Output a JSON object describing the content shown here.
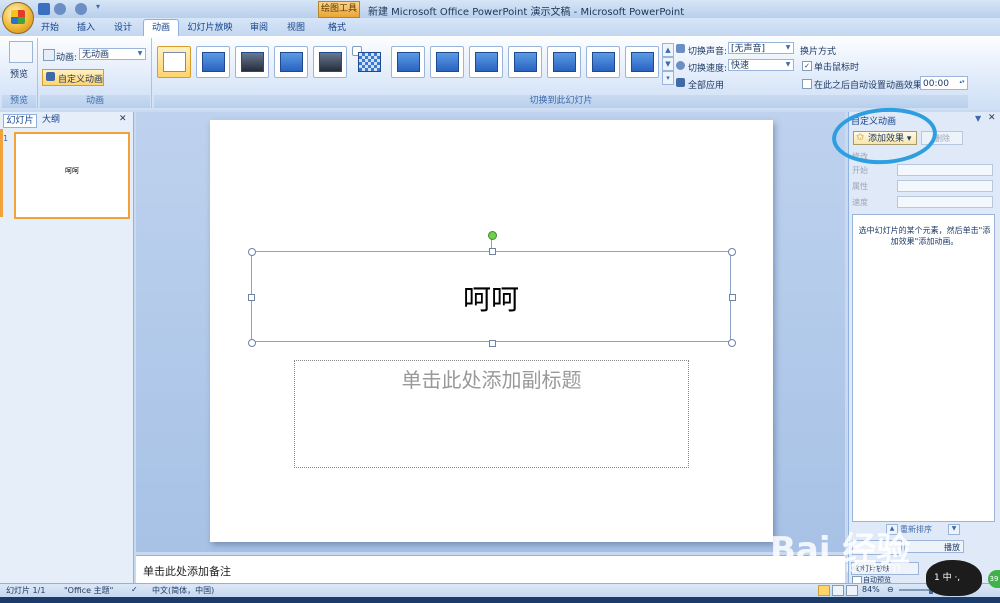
{
  "window": {
    "title": "新建 Microsoft Office PowerPoint 演示文稿 - Microsoft PowerPoint",
    "context_tab": "绘图工具"
  },
  "tabs": [
    {
      "label": "开始"
    },
    {
      "label": "插入"
    },
    {
      "label": "设计"
    },
    {
      "label": "动画",
      "active": true
    },
    {
      "label": "幻灯片放映"
    },
    {
      "label": "审阅"
    },
    {
      "label": "视图"
    },
    {
      "label": "格式"
    }
  ],
  "ribbon": {
    "preview": {
      "button_label": "预览",
      "group_label": "预览"
    },
    "animations": {
      "anim_label": "动画:",
      "anim_value": "无动画",
      "custom_button": "自定义动画",
      "group_label": "动画"
    },
    "transitions": {
      "group_label": "切换到此幻灯片",
      "sound_label": "切换声音:",
      "sound_value": "[无声音]",
      "speed_label": "切换速度:",
      "speed_value": "快速",
      "apply_all": "全部应用",
      "advance_title": "换片方式",
      "on_click": "单击鼠标时",
      "on_click_checked": true,
      "auto_label": "在此之后自动设置动画效果:",
      "auto_checked": false,
      "auto_time": "00:00"
    }
  },
  "slides_pane": {
    "tab_slides": "幻灯片",
    "tab_outline": "大纲",
    "close": "✕",
    "slide_number": "1",
    "thumb_title": "呵呵"
  },
  "slide": {
    "title": "呵呵",
    "subtitle_placeholder": "单击此处添加副标题"
  },
  "notes": {
    "placeholder": "单击此处添加备注"
  },
  "anim_pane": {
    "title": "自定义动画",
    "add_effect": "添加效果",
    "delete": "删除",
    "modify_label": "修改",
    "start_label": "开始",
    "property_label": "属性",
    "speed_label": "速度",
    "hint": "选中幻灯片的某个元素，然后单击\"添加效果\"添加动画。",
    "reorder_label": "重新排序",
    "play": "播放",
    "slideshow": "幻灯片放映",
    "autopreview": "自动预览"
  },
  "status": {
    "slide_info": "幻灯片 1/1",
    "theme": "\"Office 主题\"",
    "language": "中文(简体，中国)",
    "zoom": "84%"
  },
  "watermark": {
    "brand": "Bai 经验",
    "url": "jingyan.baidu.com",
    "mascot_text": "1  中 ·,",
    "badge": "39"
  }
}
